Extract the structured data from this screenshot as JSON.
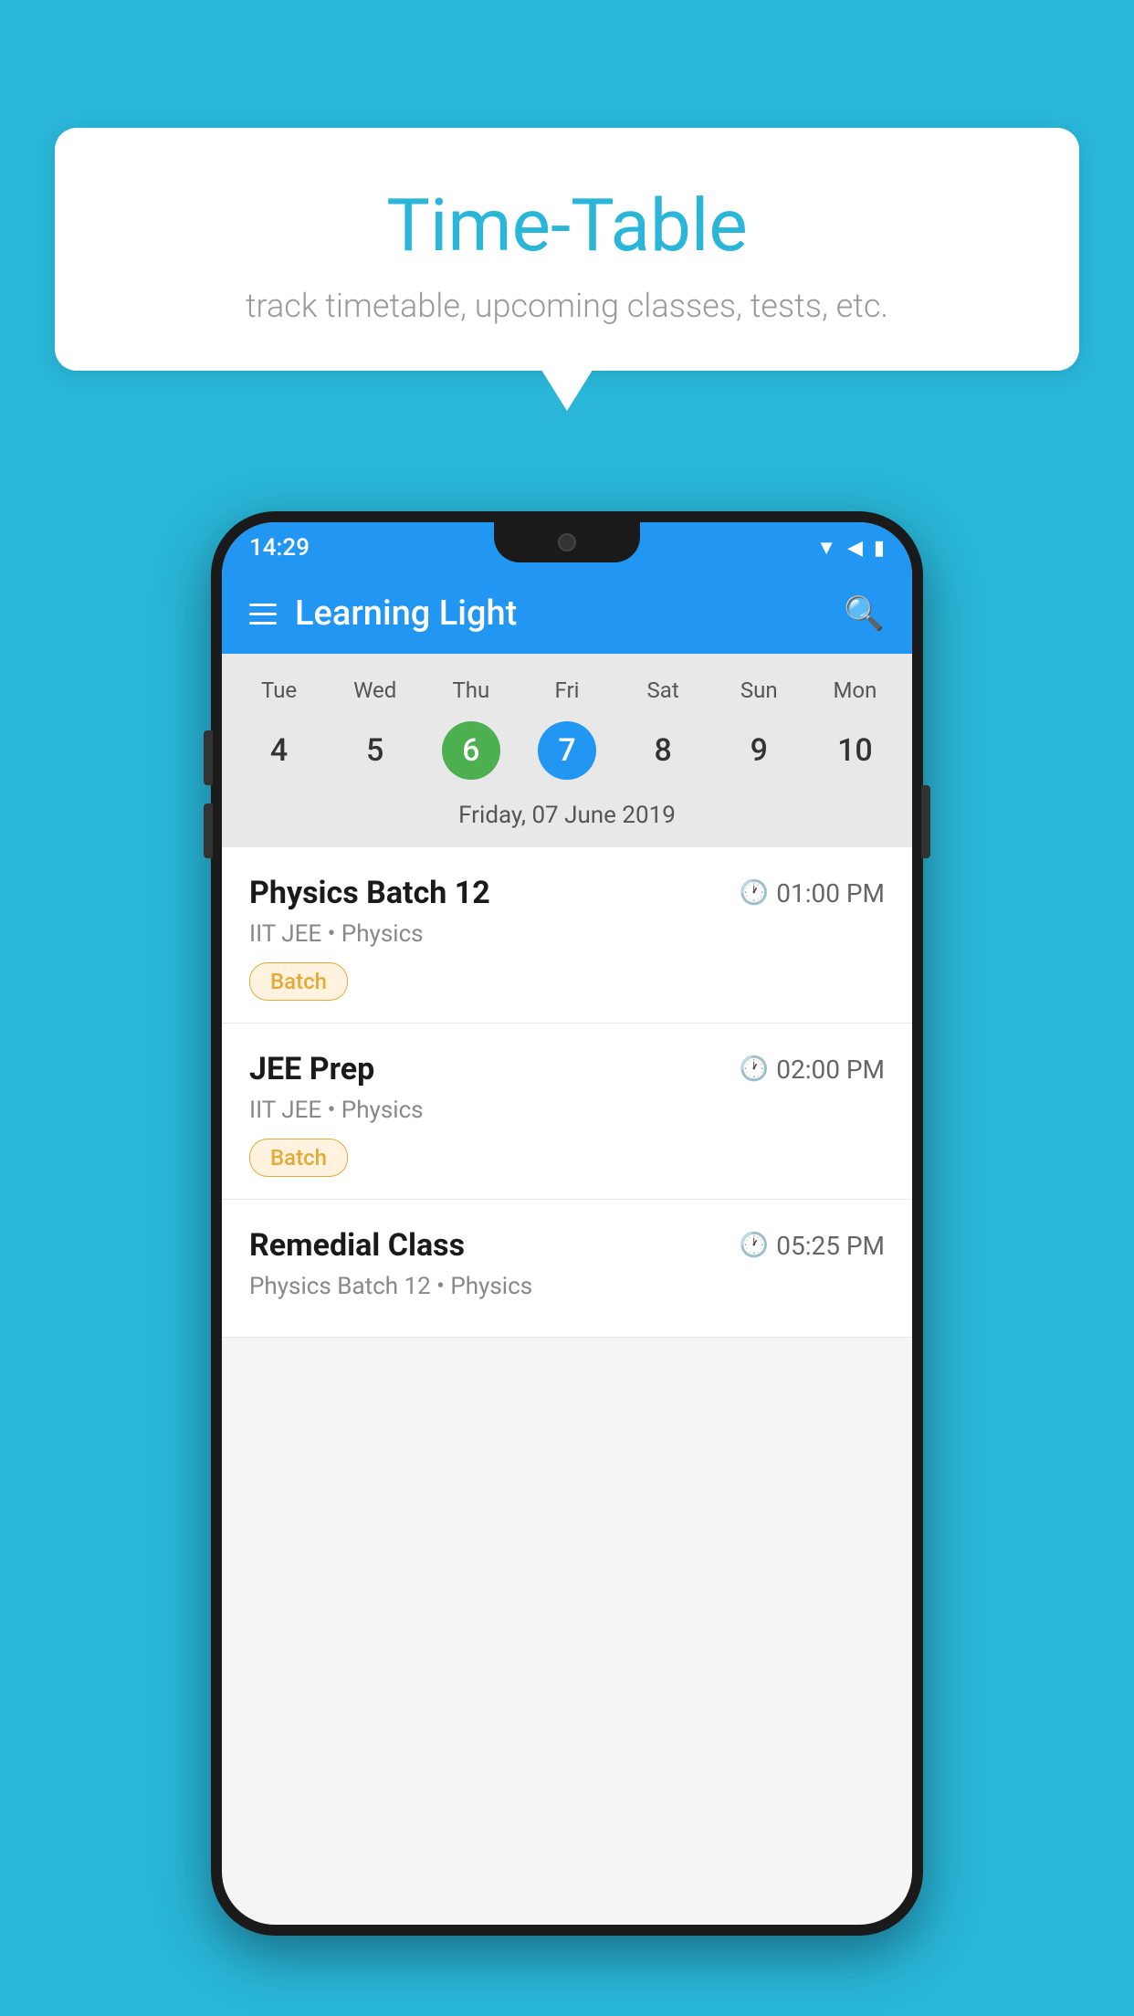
{
  "background_color": "#29B6D8",
  "speech_bubble": {
    "title": "Time-Table",
    "subtitle": "track timetable, upcoming classes, tests, etc."
  },
  "phone": {
    "status_bar": {
      "time": "14:29"
    },
    "app_bar": {
      "title": "Learning Light"
    },
    "calendar": {
      "days": [
        "Tue",
        "Wed",
        "Thu",
        "Fri",
        "Sat",
        "Sun",
        "Mon"
      ],
      "numbers": [
        "4",
        "5",
        "6",
        "7",
        "8",
        "9",
        "10"
      ],
      "today_index": 2,
      "selected_index": 3,
      "selected_date_label": "Friday, 07 June 2019"
    },
    "schedule_items": [
      {
        "title": "Physics Batch 12",
        "time": "01:00 PM",
        "meta": "IIT JEE • Physics",
        "badge": "Batch"
      },
      {
        "title": "JEE Prep",
        "time": "02:00 PM",
        "meta": "IIT JEE • Physics",
        "badge": "Batch"
      },
      {
        "title": "Remedial Class",
        "time": "05:25 PM",
        "meta": "Physics Batch 12 • Physics",
        "badge": null
      }
    ]
  }
}
